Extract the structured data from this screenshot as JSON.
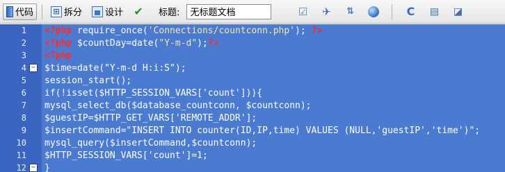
{
  "toolbar": {
    "code_label": "代码",
    "split_label": "拆分",
    "design_label": "设计",
    "live_icon": "live-view-icon",
    "title_label": "标题:",
    "title_value": "无标题文档",
    "icons": [
      "file-management-icon",
      "debug-icon",
      "validate-icon",
      "browser-preview-icon",
      "refresh-icon",
      "view-options-icon",
      "visual-aids-icon"
    ]
  },
  "editor": {
    "lines": [
      {
        "num": "1",
        "fold": "",
        "parts": [
          [
            "tag",
            "<?php"
          ],
          [
            "text",
            " require_once("
          ],
          [
            "str",
            "'Connections/countconn.php'"
          ],
          [
            "text",
            "); "
          ],
          [
            "tag",
            "?>"
          ]
        ]
      },
      {
        "num": "2",
        "fold": "",
        "parts": [
          [
            "tag",
            "<?php"
          ],
          [
            "text",
            " $countDay=date("
          ],
          [
            "str",
            "\"Y-m-d\""
          ],
          [
            "text",
            ");"
          ],
          [
            "tag",
            "?>"
          ]
        ]
      },
      {
        "num": "3",
        "fold": "",
        "parts": [
          [
            "tag",
            "<?php"
          ]
        ]
      },
      {
        "num": "4",
        "fold": "⊟",
        "parts": [
          [
            "text",
            "$time=date(\"Y-m-d H:i:S\");"
          ]
        ]
      },
      {
        "num": "5",
        "fold": "",
        "parts": [
          [
            "text",
            "session_start();"
          ]
        ]
      },
      {
        "num": "6",
        "fold": "",
        "parts": [
          [
            "text",
            "if(!isset($HTTP_SESSION_VARS['count'])){"
          ]
        ]
      },
      {
        "num": "7",
        "fold": "",
        "parts": [
          [
            "text",
            "mysql_select_db($database_countconn, $countconn);"
          ]
        ]
      },
      {
        "num": "8",
        "fold": "",
        "parts": [
          [
            "text",
            "$guestIP=$HTTP_GET_VARS['REMOTE_ADDR'];"
          ]
        ]
      },
      {
        "num": "9",
        "fold": "",
        "parts": [
          [
            "text",
            "$insertCommand=\"INSERT INTO counter(ID,IP,time) VALUES (NULL,'guestIP','time')\";"
          ]
        ]
      },
      {
        "num": "10",
        "fold": "",
        "parts": [
          [
            "text",
            "mysql_query($insertCommand,$countconn);"
          ]
        ]
      },
      {
        "num": "11",
        "fold": "",
        "parts": [
          [
            "text",
            "$HTTP_SESSION_VARS['count']=1;"
          ]
        ]
      },
      {
        "num": "12",
        "fold": "⊟",
        "parts": [
          [
            "text",
            "}"
          ]
        ]
      }
    ]
  }
}
